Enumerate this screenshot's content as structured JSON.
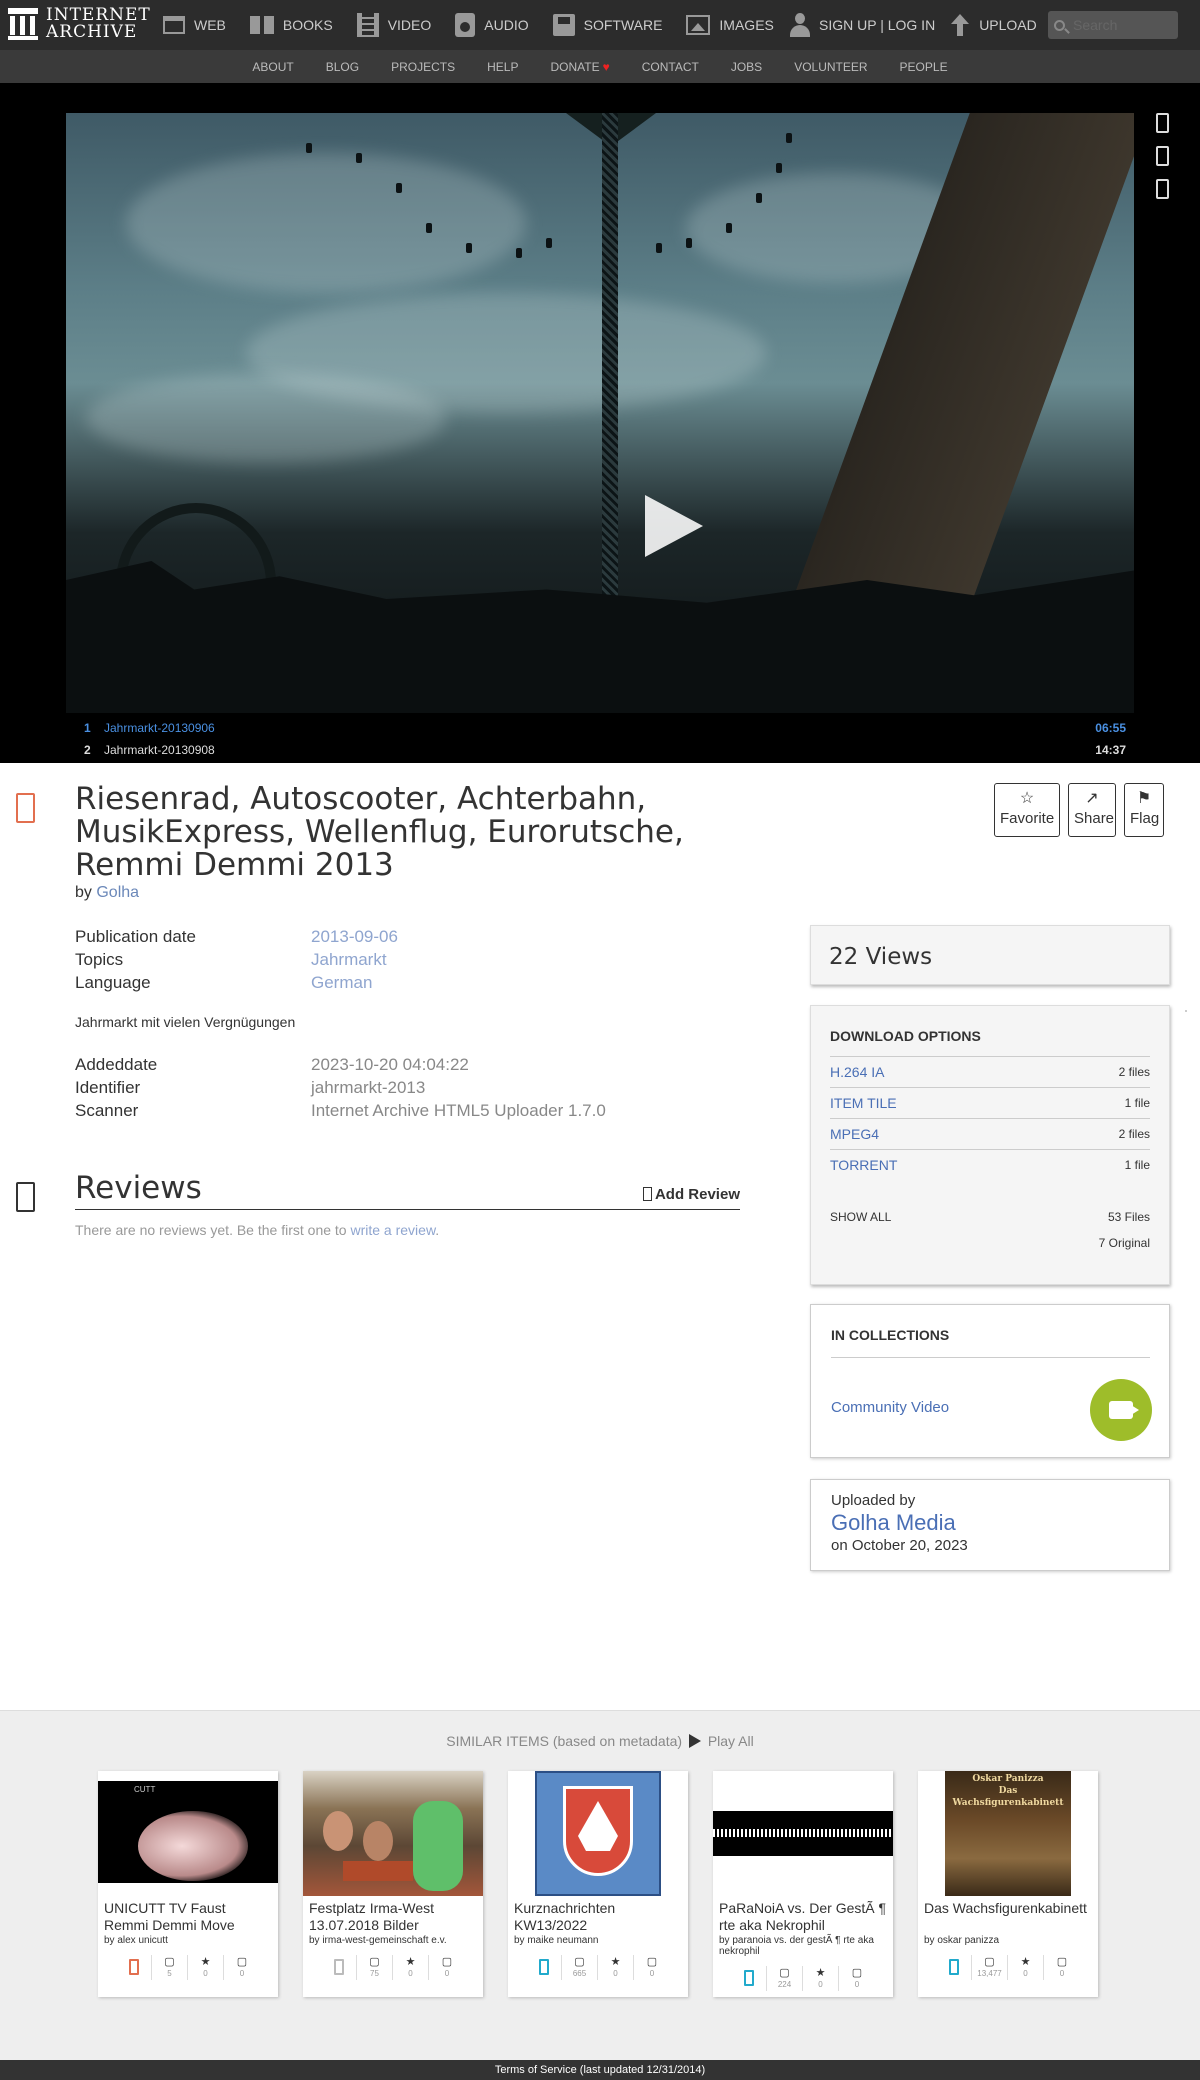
{
  "header": {
    "logo_line1": "INTERNET",
    "logo_line2": "ARCHIVE",
    "nav": [
      {
        "label": "WEB",
        "icon": "web-icon"
      },
      {
        "label": "BOOKS",
        "icon": "books-icon"
      },
      {
        "label": "VIDEO",
        "icon": "video-icon"
      },
      {
        "label": "AUDIO",
        "icon": "audio-icon"
      },
      {
        "label": "SOFTWARE",
        "icon": "software-icon"
      },
      {
        "label": "IMAGES",
        "icon": "images-icon"
      }
    ],
    "signup": "SIGN UP | LOG IN",
    "upload": "UPLOAD",
    "search_placeholder": "Search"
  },
  "subnav": [
    "ABOUT",
    "BLOG",
    "PROJECTS",
    "HELP",
    "DONATE",
    "CONTACT",
    "JOBS",
    "VOLUNTEER",
    "PEOPLE"
  ],
  "player": {
    "playlist": [
      {
        "num": "1",
        "title": "Jahrmarkt-20130906",
        "duration": "06:55"
      },
      {
        "num": "2",
        "title": "Jahrmarkt-20130908",
        "duration": "14:37"
      }
    ]
  },
  "item": {
    "title": "Riesenrad, Autoscooter, Achterbahn, MusikExpress, Wellenflug, Eurorutsche, Remmi Demmi 2013",
    "by_label": "by",
    "creator": "Golha",
    "actions": {
      "favorite": "Favorite",
      "share": "Share",
      "flag": "Flag"
    },
    "metadata": [
      {
        "key": "Publication date",
        "value": "2013-09-06"
      },
      {
        "key": "Topics",
        "value": "Jahrmarkt"
      },
      {
        "key": "Language",
        "value": "German"
      }
    ],
    "description": "Jahrmarkt mit vielen Vergnügungen",
    "metadata2": [
      {
        "key": "Addeddate",
        "value": "2023-10-20 04:04:22"
      },
      {
        "key": "Identifier",
        "value": "jahrmarkt-2013"
      },
      {
        "key": "Scanner",
        "value": "Internet Archive HTML5 Uploader 1.7.0"
      }
    ]
  },
  "reviews": {
    "title": "Reviews",
    "add": "Add Review",
    "empty_text": "There are no reviews yet. Be the first one to ",
    "empty_link": "write a review",
    "empty_end": "."
  },
  "sidebar": {
    "views": "22 Views",
    "download_heading": "DOWNLOAD OPTIONS",
    "downloads": [
      {
        "name": "H.264 IA",
        "count": "2 files"
      },
      {
        "name": "ITEM TILE",
        "count": "1 file"
      },
      {
        "name": "MPEG4",
        "count": "2 files"
      },
      {
        "name": "TORRENT",
        "count": "1 file"
      }
    ],
    "show_all": "SHOW ALL",
    "total_files": "53 Files",
    "original": "7 Original",
    "collections_heading": "IN COLLECTIONS",
    "collection": "Community Video",
    "uploaded_by_label": "Uploaded by",
    "uploader": "Golha Media",
    "upload_date": "on October 20, 2023"
  },
  "similar": {
    "heading": "SIMILAR ITEMS (based on metadata)",
    "play_all": "Play All",
    "items": [
      {
        "title": "UNICUTT TV Faust Remmi Demmi Move",
        "by": "by alex unicutt",
        "views": "5",
        "favs": "0",
        "reviews": "0",
        "type_color": "#e26f4f",
        "thumb_text": "CUTT"
      },
      {
        "title": "Festplatz Irma-West 13.07.2018 Bilder",
        "by": "by irma-west-gemeinschaft e.v.",
        "views": "75",
        "favs": "0",
        "reviews": "0",
        "type_color": "#bbbbbb"
      },
      {
        "title": "Kurznachrichten KW13/2022",
        "by": "by maike neumann",
        "views": "665",
        "favs": "0",
        "reviews": "0",
        "type_color": "#22aacc"
      },
      {
        "title": "PaRaNoiA vs. Der GestÃ ¶ rte aka Nekrophil",
        "by": "by paranoia vs. der gestÃ ¶ rte aka nekrophil",
        "views": "224",
        "favs": "0",
        "reviews": "0",
        "type_color": "#22aacc"
      },
      {
        "title": "Das Wachsfigurenkabinett",
        "by": "by oskar panizza",
        "views": "13,477",
        "favs": "0",
        "reviews": "0",
        "type_color": "#22aacc",
        "thumb_line1": "Oskar Panizza",
        "thumb_line2": "Das Wachsfigurenkabinett"
      }
    ]
  },
  "footer": {
    "text": "Terms of Service (last updated 12/31/2014)"
  }
}
